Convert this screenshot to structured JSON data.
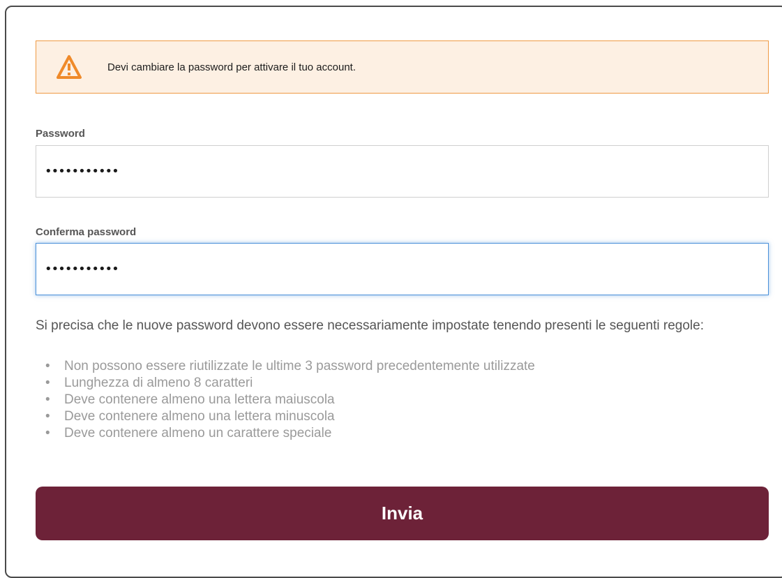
{
  "alert": {
    "icon": "warning-icon",
    "color": "#ef9a44",
    "background": "#fdf0e3",
    "message": "Devi cambiare la password per attivare il tuo account."
  },
  "form": {
    "password": {
      "label": "Password",
      "value": "•••••••••••"
    },
    "confirm_password": {
      "label": "Conferma password",
      "value": "•••••••••••"
    }
  },
  "rules": {
    "intro": "Si precisa che le nuove password devono essere necessariamente impostate tenendo presenti le seguenti regole:",
    "items": [
      "Non possono essere riutilizzate le ultime 3 password precedentemente utilizzate",
      "Lunghezza di almeno 8 caratteri",
      "Deve contenere almeno una lettera maiuscola",
      "Deve contenere almeno una lettera minuscola",
      "Deve contenere almeno un carattere speciale"
    ]
  },
  "submit": {
    "label": "Invia",
    "color": "#6d2238"
  }
}
